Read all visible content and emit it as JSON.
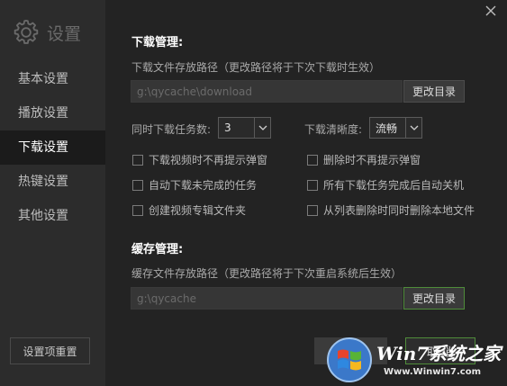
{
  "window": {
    "title": "设置"
  },
  "sidebar": {
    "items": [
      {
        "label": "基本设置"
      },
      {
        "label": "播放设置"
      },
      {
        "label": "下载设置"
      },
      {
        "label": "热键设置"
      },
      {
        "label": "其他设置"
      }
    ],
    "active_index": 2,
    "reset_label": "设置项重置"
  },
  "download": {
    "section_title": "下载管理:",
    "path_label": "下载文件存放路径（更改路径将于下次下载时生效）",
    "path_value": "g:\\qycache\\download",
    "change_label": "更改目录",
    "tasks_label": "同时下载任务数:",
    "tasks_value": "3",
    "quality_label": "下载清晰度:",
    "quality_value": "流畅",
    "options": [
      {
        "label": "下载视频时不再提示弹窗",
        "checked": false
      },
      {
        "label": "删除时不再提示弹窗",
        "checked": false
      },
      {
        "label": "自动下载未完成的任务",
        "checked": false
      },
      {
        "label": "所有下载任务完成后自动关机",
        "checked": false
      },
      {
        "label": "创建视频专辑文件夹",
        "checked": false
      },
      {
        "label": "从列表删除时同时删除本地文件",
        "checked": false
      }
    ]
  },
  "cache": {
    "section_title": "缓存管理:",
    "path_label": "缓存文件存放路径（更改路径将于下次重启系统后生效）",
    "path_value": "g:\\qycache",
    "change_label": "更改目录"
  },
  "footer": {
    "ok_label": "",
    "cancel_label": "取 消"
  },
  "watermark": {
    "brand": "Win7系统之家",
    "url": "Www.Winwin7.com"
  },
  "colors": {
    "accent_green": "#4f8c3a",
    "background": "#232323",
    "sidebar": "#2c2c2c"
  }
}
